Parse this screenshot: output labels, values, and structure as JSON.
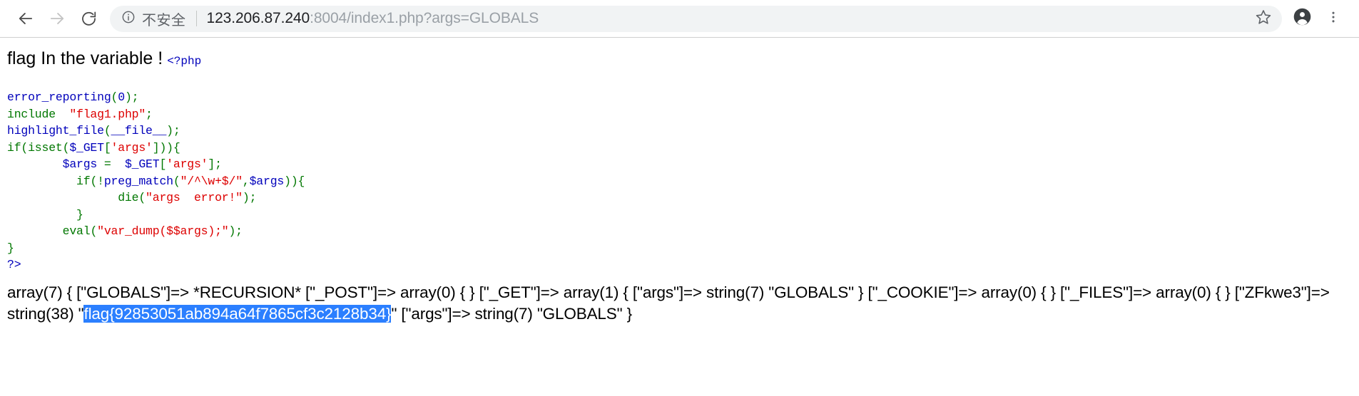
{
  "browser": {
    "back_icon": "arrow-left-icon",
    "forward_icon": "arrow-right-icon",
    "reload_icon": "reload-icon",
    "info_icon": "info-circle-icon",
    "security_label": "不安全",
    "url_host": "123.206.87.240",
    "url_path": ":8004/index1.php?args=GLOBALS",
    "url_full": "123.206.87.240:8004/index1.php?args=GLOBALS",
    "star_icon": "star-bookmark-icon",
    "profile_icon": "profile-avatar-icon",
    "menu_icon": "three-dot-menu-icon",
    "colors": {
      "omnibox_bg": "#f1f3f4",
      "url_gray": "#9aa0a6",
      "url_dark": "#202124"
    }
  },
  "page": {
    "heading": "flag In the variable !",
    "php_open_tag": "<?php",
    "code_lines": [
      [
        {
          "t": "error_reporting",
          "c": "def"
        },
        {
          "t": "(",
          "c": "kw"
        },
        {
          "t": "0",
          "c": "def"
        },
        {
          "t": ")",
          "c": "kw"
        },
        {
          "t": ";",
          "c": "kw"
        }
      ],
      [
        {
          "t": "include",
          "c": "kw"
        },
        {
          "t": "  ",
          "c": "def"
        },
        {
          "t": "\"flag1.php\"",
          "c": "str"
        },
        {
          "t": ";",
          "c": "kw"
        }
      ],
      [
        {
          "t": "highlight_file",
          "c": "def"
        },
        {
          "t": "(",
          "c": "kw"
        },
        {
          "t": "__file__",
          "c": "def"
        },
        {
          "t": ")",
          "c": "kw"
        },
        {
          "t": ";",
          "c": "kw"
        }
      ],
      [
        {
          "t": "if",
          "c": "kw"
        },
        {
          "t": "(",
          "c": "kw"
        },
        {
          "t": "isset",
          "c": "kw"
        },
        {
          "t": "(",
          "c": "kw"
        },
        {
          "t": "$_GET",
          "c": "def"
        },
        {
          "t": "[",
          "c": "kw"
        },
        {
          "t": "'args'",
          "c": "str"
        },
        {
          "t": "]))",
          "c": "kw"
        },
        {
          "t": "{",
          "c": "kw"
        }
      ],
      [
        {
          "t": "        ",
          "c": "def"
        },
        {
          "t": "$args",
          "c": "def"
        },
        {
          "t": " = ",
          "c": "kw"
        },
        {
          "t": " $_GET",
          "c": "def"
        },
        {
          "t": "[",
          "c": "kw"
        },
        {
          "t": "'args'",
          "c": "str"
        },
        {
          "t": "];",
          "c": "kw"
        }
      ],
      [
        {
          "t": "          ",
          "c": "def"
        },
        {
          "t": "if",
          "c": "kw"
        },
        {
          "t": "(!",
          "c": "kw"
        },
        {
          "t": "preg_match",
          "c": "def"
        },
        {
          "t": "(",
          "c": "kw"
        },
        {
          "t": "\"/^\\w+$/\"",
          "c": "str"
        },
        {
          "t": ",",
          "c": "kw"
        },
        {
          "t": "$args",
          "c": "def"
        },
        {
          "t": "))",
          "c": "kw"
        },
        {
          "t": "{",
          "c": "kw"
        }
      ],
      [
        {
          "t": "                ",
          "c": "def"
        },
        {
          "t": "die",
          "c": "kw"
        },
        {
          "t": "(",
          "c": "kw"
        },
        {
          "t": "\"args  error!\"",
          "c": "str"
        },
        {
          "t": ");",
          "c": "kw"
        }
      ],
      [
        {
          "t": "          ",
          "c": "def"
        },
        {
          "t": "}",
          "c": "kw"
        }
      ],
      [
        {
          "t": "        ",
          "c": "def"
        },
        {
          "t": "eval",
          "c": "kw"
        },
        {
          "t": "(",
          "c": "kw"
        },
        {
          "t": "\"var_dump($$args);\"",
          "c": "str"
        },
        {
          "t": ");",
          "c": "kw"
        }
      ],
      [
        {
          "t": "}",
          "c": "kw"
        }
      ],
      [
        {
          "t": "?>",
          "c": "def"
        }
      ]
    ],
    "var_dump": {
      "prefix": "array(7) { [\"GLOBALS\"]=> *RECURSION* [\"_POST\"]=> array(0) { } [\"_GET\"]=> array(1) { [\"args\"]=> string(7) \"GLOBALS\" } [\"_COOKIE\"]=> array(0) { } [\"_FILES\"]=> array(0) { } [\"ZFkwe3\"]=> string(38) \"",
      "flag": "flag{92853051ab894a64f7865cf3c2128b34}",
      "suffix": "\" [\"args\"]=> string(7) \"GLOBALS\" }",
      "selection_color": "#2b7fff"
    }
  }
}
